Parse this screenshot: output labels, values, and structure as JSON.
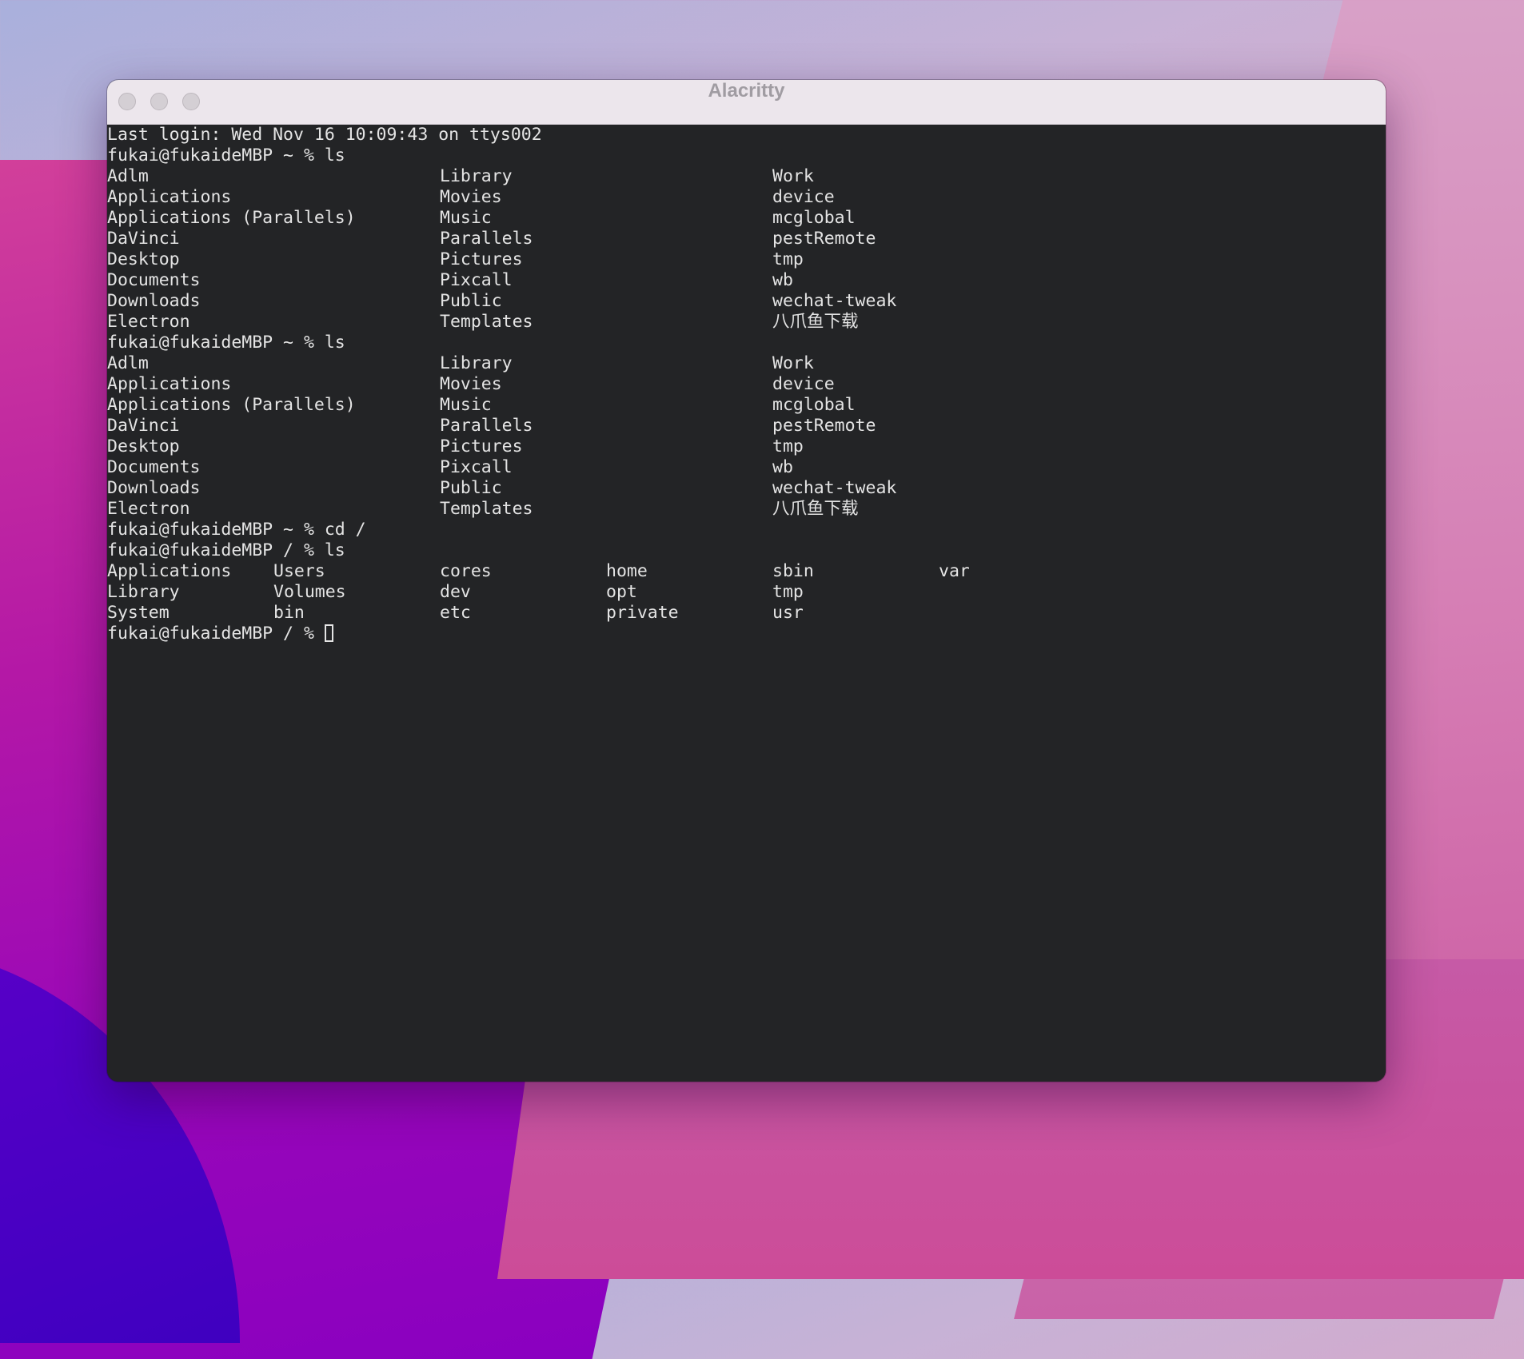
{
  "desktop": {
    "wallpaper": "macOS Monterey gradient"
  },
  "window": {
    "title": "Alacritty",
    "buttons": [
      "close",
      "minimize",
      "zoom"
    ]
  },
  "terminal": {
    "colors": {
      "background": "#232426",
      "foreground": "#e4e4e4"
    },
    "lines": [
      {
        "cells": [
          {
            "col": 0,
            "text": "Last login: Wed Nov 16 10:09:43 on ttys002"
          }
        ]
      },
      {
        "cells": [
          {
            "col": 0,
            "text": "fukai@fukaideMBP ~ % ls"
          }
        ],
        "prompt": true
      },
      {
        "cells": [
          {
            "col": 0,
            "text": "Adlm"
          },
          {
            "col": 32,
            "text": "Library"
          },
          {
            "col": 64,
            "text": "Work"
          }
        ]
      },
      {
        "cells": [
          {
            "col": 0,
            "text": "Applications"
          },
          {
            "col": 32,
            "text": "Movies"
          },
          {
            "col": 64,
            "text": "device"
          }
        ]
      },
      {
        "cells": [
          {
            "col": 0,
            "text": "Applications (Parallels)"
          },
          {
            "col": 32,
            "text": "Music"
          },
          {
            "col": 64,
            "text": "mcglobal"
          }
        ]
      },
      {
        "cells": [
          {
            "col": 0,
            "text": "DaVinci"
          },
          {
            "col": 32,
            "text": "Parallels"
          },
          {
            "col": 64,
            "text": "pestRemote"
          }
        ]
      },
      {
        "cells": [
          {
            "col": 0,
            "text": "Desktop"
          },
          {
            "col": 32,
            "text": "Pictures"
          },
          {
            "col": 64,
            "text": "tmp"
          }
        ]
      },
      {
        "cells": [
          {
            "col": 0,
            "text": "Documents"
          },
          {
            "col": 32,
            "text": "Pixcall"
          },
          {
            "col": 64,
            "text": "wb"
          }
        ]
      },
      {
        "cells": [
          {
            "col": 0,
            "text": "Downloads"
          },
          {
            "col": 32,
            "text": "Public"
          },
          {
            "col": 64,
            "text": "wechat-tweak"
          }
        ]
      },
      {
        "cells": [
          {
            "col": 0,
            "text": "Electron"
          },
          {
            "col": 32,
            "text": "Templates"
          },
          {
            "col": 64,
            "text": "八爪鱼下载"
          }
        ]
      },
      {
        "cells": [
          {
            "col": 0,
            "text": "fukai@fukaideMBP ~ % ls"
          }
        ],
        "prompt": true
      },
      {
        "cells": [
          {
            "col": 0,
            "text": "Adlm"
          },
          {
            "col": 32,
            "text": "Library"
          },
          {
            "col": 64,
            "text": "Work"
          }
        ]
      },
      {
        "cells": [
          {
            "col": 0,
            "text": "Applications"
          },
          {
            "col": 32,
            "text": "Movies"
          },
          {
            "col": 64,
            "text": "device"
          }
        ]
      },
      {
        "cells": [
          {
            "col": 0,
            "text": "Applications (Parallels)"
          },
          {
            "col": 32,
            "text": "Music"
          },
          {
            "col": 64,
            "text": "mcglobal"
          }
        ]
      },
      {
        "cells": [
          {
            "col": 0,
            "text": "DaVinci"
          },
          {
            "col": 32,
            "text": "Parallels"
          },
          {
            "col": 64,
            "text": "pestRemote"
          }
        ]
      },
      {
        "cells": [
          {
            "col": 0,
            "text": "Desktop"
          },
          {
            "col": 32,
            "text": "Pictures"
          },
          {
            "col": 64,
            "text": "tmp"
          }
        ]
      },
      {
        "cells": [
          {
            "col": 0,
            "text": "Documents"
          },
          {
            "col": 32,
            "text": "Pixcall"
          },
          {
            "col": 64,
            "text": "wb"
          }
        ]
      },
      {
        "cells": [
          {
            "col": 0,
            "text": "Downloads"
          },
          {
            "col": 32,
            "text": "Public"
          },
          {
            "col": 64,
            "text": "wechat-tweak"
          }
        ]
      },
      {
        "cells": [
          {
            "col": 0,
            "text": "Electron"
          },
          {
            "col": 32,
            "text": "Templates"
          },
          {
            "col": 64,
            "text": "八爪鱼下载"
          }
        ]
      },
      {
        "cells": [
          {
            "col": 0,
            "text": "fukai@fukaideMBP ~ % cd /"
          }
        ],
        "prompt": true
      },
      {
        "cells": [
          {
            "col": 0,
            "text": "fukai@fukaideMBP / % ls"
          }
        ],
        "prompt": true
      },
      {
        "cells": [
          {
            "col": 0,
            "text": "Applications"
          },
          {
            "col": 16,
            "text": "Users"
          },
          {
            "col": 32,
            "text": "cores"
          },
          {
            "col": 48,
            "text": "home"
          },
          {
            "col": 64,
            "text": "sbin"
          },
          {
            "col": 80,
            "text": "var"
          }
        ]
      },
      {
        "cells": [
          {
            "col": 0,
            "text": "Library"
          },
          {
            "col": 16,
            "text": "Volumes"
          },
          {
            "col": 32,
            "text": "dev"
          },
          {
            "col": 48,
            "text": "opt"
          },
          {
            "col": 64,
            "text": "tmp"
          }
        ]
      },
      {
        "cells": [
          {
            "col": 0,
            "text": "System"
          },
          {
            "col": 16,
            "text": "bin"
          },
          {
            "col": 32,
            "text": "etc"
          },
          {
            "col": 48,
            "text": "private"
          },
          {
            "col": 64,
            "text": "usr"
          }
        ]
      },
      {
        "cells": [
          {
            "col": 0,
            "text": "fukai@fukaideMBP / % "
          }
        ],
        "prompt": true,
        "cursor": true
      }
    ]
  }
}
